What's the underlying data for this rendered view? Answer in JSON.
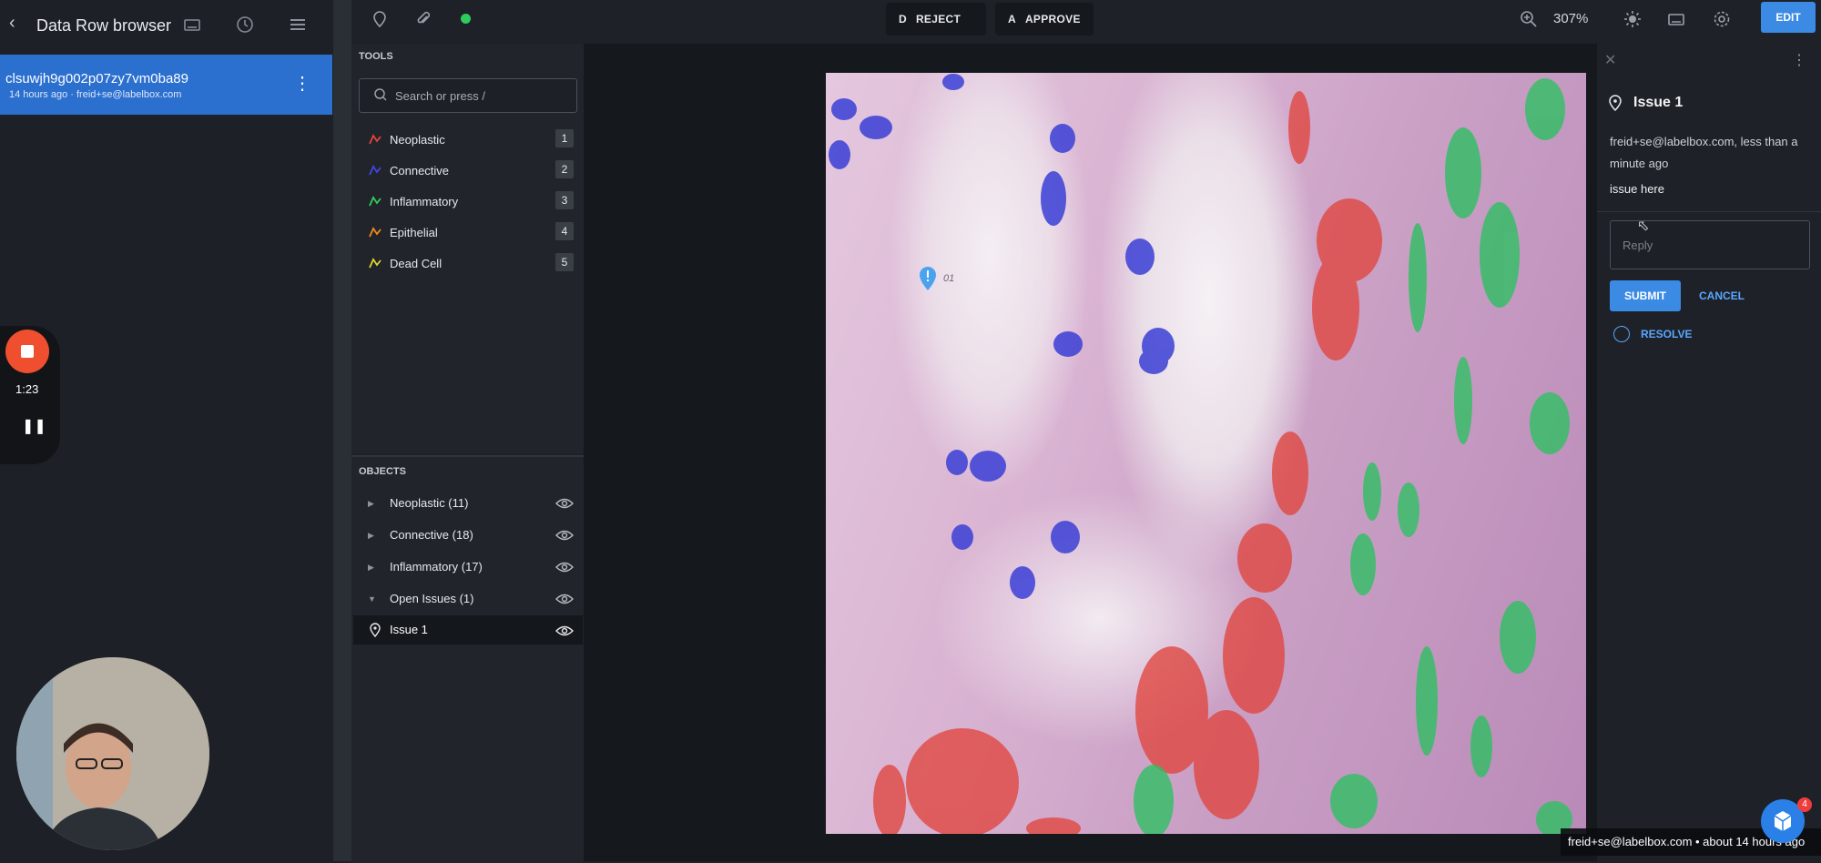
{
  "left": {
    "title": "Data Row browser",
    "row": {
      "id": "clsuwjh9g002p07zy7vm0ba89",
      "meta": "14 hours ago · freid+se@labelbox.com"
    },
    "recorder": {
      "time": "1:23"
    }
  },
  "toolbar": {
    "reject": {
      "key": "D",
      "label": "REJECT"
    },
    "approve": {
      "key": "A",
      "label": "APPROVE"
    },
    "zoom": "307%",
    "edit": "EDIT",
    "status_color": "#2ecb5d"
  },
  "tools": {
    "title": "TOOLS",
    "search_placeholder": "Search or press /",
    "items": [
      {
        "label": "Neoplastic",
        "num": "1",
        "color": "#e0453e"
      },
      {
        "label": "Connective",
        "num": "2",
        "color": "#3f48e0"
      },
      {
        "label": "Inflammatory",
        "num": "3",
        "color": "#2fcf5a"
      },
      {
        "label": "Epithelial",
        "num": "4",
        "color": "#f08a1c"
      },
      {
        "label": "Dead Cell",
        "num": "5",
        "color": "#e3d22f"
      }
    ]
  },
  "objects": {
    "title": "OBJECTS",
    "items": [
      {
        "label": "Neoplastic (11)"
      },
      {
        "label": "Connective (18)"
      },
      {
        "label": "Inflammatory (17)"
      },
      {
        "label": "Open Issues (1)"
      }
    ],
    "issue_label": "Issue 1"
  },
  "canvas": {
    "marker_label": "01"
  },
  "issue_panel": {
    "title": "Issue 1",
    "author": "freid+se@labelbox.com, less than a minute ago",
    "body": "issue here",
    "reply_placeholder": "Reply",
    "submit": "SUBMIT",
    "cancel": "CANCEL",
    "resolve": "RESOLVE"
  },
  "footer": {
    "text": "freid+se@labelbox.com • about 14 hours ago"
  },
  "chat": {
    "count": "4"
  }
}
